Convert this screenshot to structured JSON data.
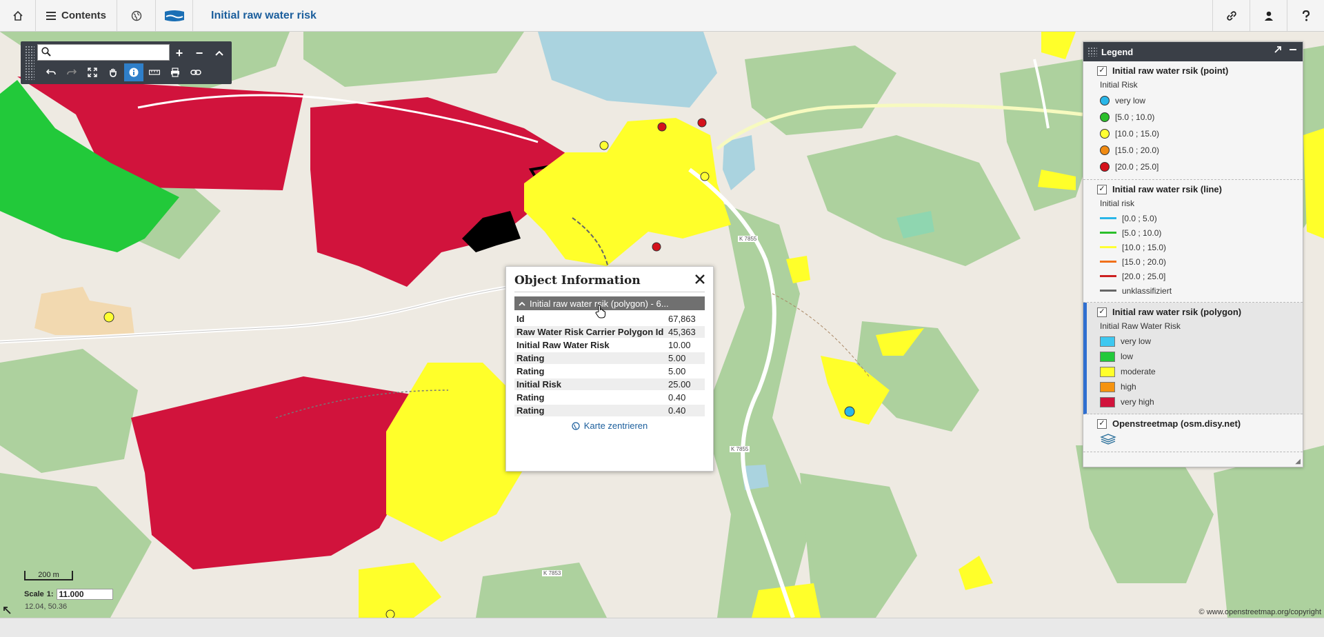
{
  "header": {
    "contents_label": "Contents",
    "title": "Initial raw water risk",
    "icons": [
      "home-icon",
      "menu-icon",
      "globe-icon",
      "logo-icon",
      "link-icon",
      "user-icon",
      "help-icon"
    ]
  },
  "map_toolbar": {
    "search_placeholder": "",
    "buttons": [
      "zoom-in",
      "zoom-out",
      "collapse",
      "undo",
      "redo",
      "full-extent",
      "pan",
      "info",
      "measure",
      "print",
      "link"
    ]
  },
  "legend": {
    "title": "Legend",
    "sections": [
      {
        "title": "Initial raw water rsik (point)",
        "subtitle": "Initial Risk",
        "items": [
          {
            "label": "very low",
            "color": "#29b6e8"
          },
          {
            "label": "[5.0 ; 10.0)",
            "color": "#2bbf2b"
          },
          {
            "label": "[10.0 ; 15.0)",
            "color": "#ffff33"
          },
          {
            "label": "[15.0 ; 20.0)",
            "color": "#f08a12"
          },
          {
            "label": "[20.0 ; 25.0]",
            "color": "#d4111b"
          }
        ]
      },
      {
        "title": "Initial raw water rsik (line)",
        "subtitle": "Initial risk",
        "items": [
          {
            "label": "[0.0 ; 5.0)",
            "color": "#29b6e8"
          },
          {
            "label": "[5.0 ; 10.0)",
            "color": "#2bbf2b"
          },
          {
            "label": "[10.0 ; 15.0)",
            "color": "#ffff33"
          },
          {
            "label": "[15.0 ; 20.0)",
            "color": "#f0701a"
          },
          {
            "label": "[20.0 ; 25.0]",
            "color": "#cc2020"
          },
          {
            "label": "unklassifiziert",
            "color": "#666666"
          }
        ]
      },
      {
        "title": "Initial raw water rsik (polygon)",
        "subtitle": "Initial Raw Water Risk",
        "items": [
          {
            "label": "very low",
            "color": "#3ec8f0"
          },
          {
            "label": "low",
            "color": "#22c93a"
          },
          {
            "label": "moderate",
            "color": "#ffff2a"
          },
          {
            "label": "high",
            "color": "#f5930f"
          },
          {
            "label": "very high",
            "color": "#d1133c"
          }
        ]
      },
      {
        "title": "Openstreetmap (osm.disy.net)"
      }
    ]
  },
  "object_info": {
    "title": "Object Information",
    "group_label": "Initial raw water rsik (polygon) - 6...",
    "rows": [
      {
        "key": "Id",
        "value": "67,863"
      },
      {
        "key": "Raw Water Risk Carrier Polygon Id",
        "value": "45,363"
      },
      {
        "key": "Initial Raw Water Risk",
        "value": "10.00"
      },
      {
        "key": "Rating",
        "value": "5.00"
      },
      {
        "key": "Rating",
        "value": "5.00"
      },
      {
        "key": "Initial Risk",
        "value": "25.00"
      },
      {
        "key": "Rating",
        "value": "0.40"
      },
      {
        "key": "Rating",
        "value": "0.40"
      }
    ],
    "link_label": "Karte zentrieren"
  },
  "map": {
    "scale_bar_label": "200 m",
    "scale_label": "Scale",
    "scale_prefix": "1:",
    "scale_value": "11.000",
    "coordinates": "12.04, 50.36",
    "copyright": "© www.openstreetmap.org/copyright",
    "road_labels": [
      "K 7855",
      "K 7855",
      "K 7853"
    ]
  }
}
